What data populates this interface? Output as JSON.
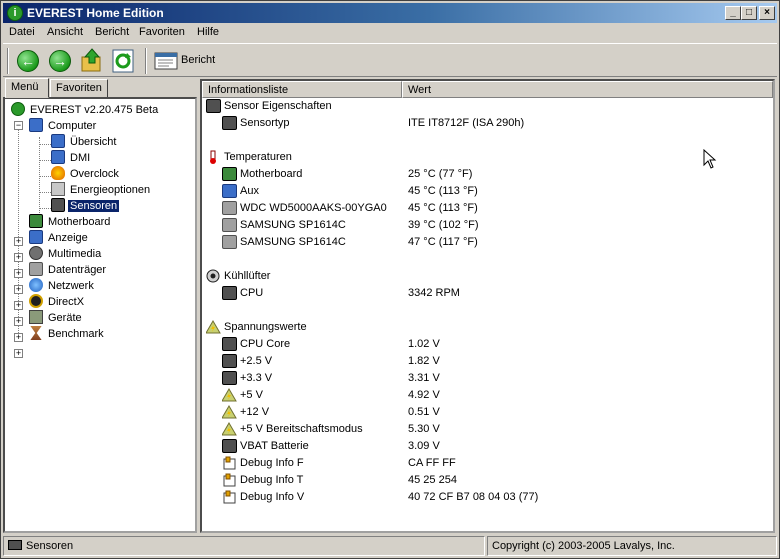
{
  "window": {
    "title": "EVEREST Home Edition",
    "buttons": {
      "minimize": "_",
      "maximize": "□",
      "close": "×"
    }
  },
  "menubar": {
    "items": [
      {
        "label": "Datei"
      },
      {
        "label": "Ansicht"
      },
      {
        "label": "Bericht"
      },
      {
        "label": "Favoriten"
      },
      {
        "label": "Hilfe"
      }
    ]
  },
  "toolbar": {
    "back_icon": "back-arrow-icon",
    "forward_icon": "forward-arrow-icon",
    "up_icon": "up-folder-icon",
    "refresh_icon": "refresh-icon",
    "report_label": "Bericht"
  },
  "left": {
    "tabs": [
      {
        "label": "Menü",
        "active": true
      },
      {
        "label": "Favoriten",
        "active": false
      }
    ],
    "tree": {
      "root": "EVEREST v2.20.475 Beta",
      "computer": "Computer",
      "computer_children": [
        "Übersicht",
        "DMI",
        "Overclock",
        "Energieoptionen",
        "Sensoren"
      ],
      "selected": "Sensoren",
      "others": [
        "Motherboard",
        "Anzeige",
        "Multimedia",
        "Datenträger",
        "Netzwerk",
        "DirectX",
        "Geräte",
        "Benchmark"
      ]
    }
  },
  "list": {
    "columns": [
      "Informationsliste",
      "Wert"
    ],
    "sections": [
      {
        "title": "Sensor Eigenschaften",
        "icon": "chip-icon",
        "items": [
          {
            "name": "Sensortyp",
            "value": "ITE IT8712F  (ISA 290h)",
            "icon": "chip-icon"
          }
        ]
      },
      {
        "title": "Temperaturen",
        "icon": "thermometer-icon",
        "items": [
          {
            "name": "Motherboard",
            "value": "25 °C  (77 °F)",
            "icon": "motherboard-icon"
          },
          {
            "name": "Aux",
            "value": "45 °C  (113 °F)",
            "icon": "computer-icon"
          },
          {
            "name": "WDC WD5000AAKS-00YGA0",
            "value": "45 °C  (113 °F)",
            "icon": "hard-disk-icon"
          },
          {
            "name": "SAMSUNG SP1614C",
            "value": "39 °C  (102 °F)",
            "icon": "hard-disk-icon"
          },
          {
            "name": "SAMSUNG SP1614C",
            "value": "47 °C  (117 °F)",
            "icon": "hard-disk-icon"
          }
        ]
      },
      {
        "title": "Kühllüfter",
        "icon": "fan-icon",
        "items": [
          {
            "name": "CPU",
            "value": "3342 RPM",
            "icon": "cpu-icon"
          }
        ]
      },
      {
        "title": "Spannungswerte",
        "icon": "voltage-icon",
        "items": [
          {
            "name": "CPU Core",
            "value": "1.02 V",
            "icon": "cpu-icon"
          },
          {
            "name": "+2.5 V",
            "value": "1.82 V",
            "icon": "cpu-icon"
          },
          {
            "name": "+3.3 V",
            "value": "3.31 V",
            "icon": "cpu-icon"
          },
          {
            "name": "+5 V",
            "value": "4.92 V",
            "icon": "voltage-icon"
          },
          {
            "name": "+12 V",
            "value": "0.51 V",
            "icon": "voltage-icon"
          },
          {
            "name": "+5 V Bereitschaftsmodus",
            "value": "5.30 V",
            "icon": "voltage-icon"
          },
          {
            "name": "VBAT Batterie",
            "value": "3.09 V",
            "icon": "battery-icon"
          },
          {
            "name": "Debug Info F",
            "value": "CA FF FF",
            "icon": "debug-icon"
          },
          {
            "name": "Debug Info T",
            "value": "45 25 254",
            "icon": "debug-icon"
          },
          {
            "name": "Debug Info V",
            "value": "40 72 CF B7 08 04 03 (77)",
            "icon": "debug-icon"
          }
        ]
      }
    ]
  },
  "statusbar": {
    "left": "Sensoren",
    "right": "Copyright (c) 2003-2005 Lavalys, Inc."
  }
}
